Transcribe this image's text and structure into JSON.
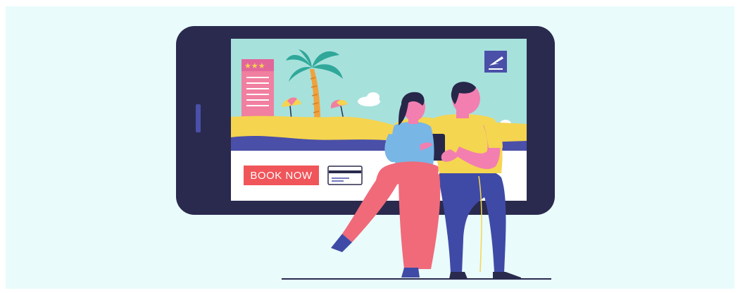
{
  "booking": {
    "button_label": "BOOK NOW"
  },
  "icons": {
    "hotel": "hotel-building-icon",
    "flight": "airplane-departure-icon",
    "card": "credit-card-icon"
  },
  "colors": {
    "background": "#e9fbfb",
    "phone_body": "#2a2a4e",
    "sky": "#a7e1dc",
    "sand": "#f5d44f",
    "sea": "#4a4fa8",
    "hotel": "#f07fa0",
    "palm_leaves": "#2fa89a",
    "palm_trunk": "#f0a23d",
    "book_button": "#f0555a",
    "woman_shirt": "#78b6e6",
    "woman_pants": "#f06a7a",
    "man_shirt": "#f5d650",
    "man_pants": "#3f4aa6",
    "skin": "#f27fb0",
    "hair": "#27274a"
  }
}
